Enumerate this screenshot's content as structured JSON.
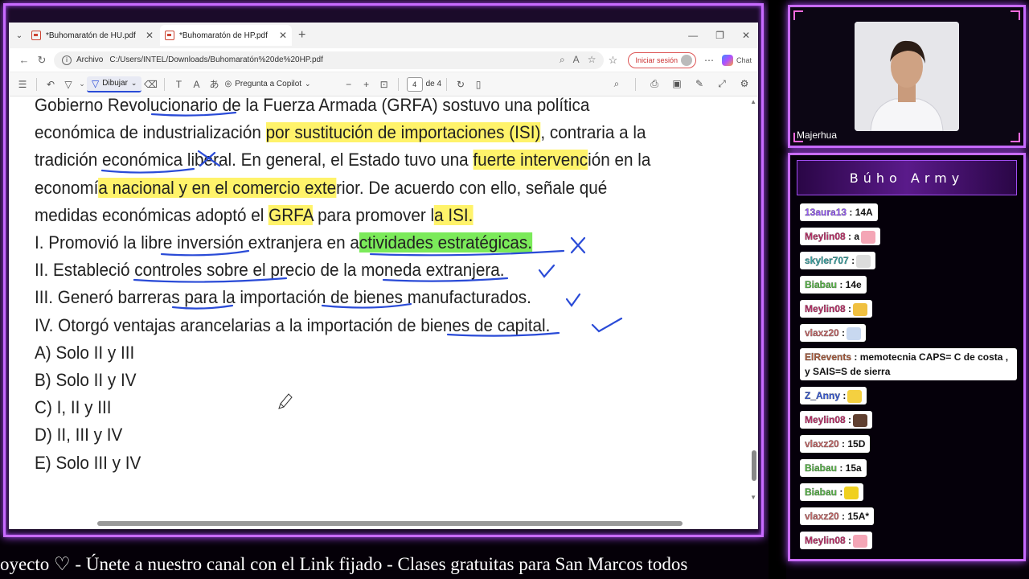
{
  "browser": {
    "tabs": [
      {
        "label": "*Buhomaratón de HU.pdf"
      },
      {
        "label": "*Buhomaratón de HP.pdf"
      }
    ],
    "address": {
      "label": "Archivo",
      "url": "C:/Users/INTEL/Downloads/Buhomaratón%20de%20HP.pdf"
    },
    "signin_label": "Iniciar sesión",
    "chat_label": "Chat"
  },
  "pdf_toolbar": {
    "draw_label": "Dibujar",
    "ask_label": "Pregunta a Copilot",
    "page_current": "4",
    "page_total": "de 4"
  },
  "document": {
    "para_lines": [
      [
        "Gobierno Revolucionario de la Fuerza Armada (GRFA) sostuvo una política"
      ],
      [
        "económica de industrialización ",
        {
          "hl": "por sustitución de importaciones (ISI)"
        },
        ", contraria a la"
      ],
      [
        "tradición económica liberal. En general, el Estado tuvo una ",
        {
          "hl": "fuerte intervenc"
        },
        "ión en la"
      ],
      [
        "economí",
        {
          "hl": "a nacional y en el comercio exte"
        },
        "rior. De acuerdo con ello, señale qué"
      ],
      [
        "medidas económicas adoptó el ",
        {
          "hl": "GRFA"
        },
        " para promover l",
        {
          "hl": "a ISI."
        }
      ]
    ],
    "statements": [
      [
        "I. Promovió la libre inversión extranjera en a",
        {
          "hlg": "ctividades estratégicas."
        }
      ],
      [
        "II. Estableció controles sobre el precio de la moneda extranjera."
      ],
      [
        "III. Generó barreras para la importación de bienes manufacturados."
      ],
      [
        "IV. Otorgó ventajas arancelarias a la importación de bienes de capital."
      ]
    ],
    "options": [
      "A) Solo II y III",
      "B) Solo II y IV",
      "C) I, II y III",
      "D) II, III y IV",
      "E) Solo III y IV"
    ]
  },
  "webcam": {
    "name": "Majerhua"
  },
  "chat": {
    "title": "Búho Army",
    "messages": [
      {
        "user": "13aura13",
        "text": ": 14A",
        "color": "#9a5cff"
      },
      {
        "user": "Meylin08",
        "text": ": a",
        "color": "#c0306a",
        "emote": "#f4a6b6"
      },
      {
        "user": "skyler707",
        "text": ":",
        "color": "#3aa6a6",
        "emote": "#dcdcdc"
      },
      {
        "user": "Biabau",
        "text": ": 14e",
        "color": "#58b848"
      },
      {
        "user": "Meylin08",
        "text": ":",
        "color": "#c0306a",
        "emote": "#f0c040"
      },
      {
        "user": "vlaxz20",
        "text": ":",
        "color": "#c86a6a",
        "emote": "#c8d8f0"
      },
      {
        "user": "ElRevents",
        "text": ": memotecnia CAPS= C de costa , y SAIS=S de sierra",
        "color": "#b06040"
      },
      {
        "user": "Z_Anny",
        "text": ":",
        "color": "#3a5cd8",
        "emote": "#f4d040"
      },
      {
        "user": "Meylin08",
        "text": ":",
        "color": "#c0306a",
        "emote": "#604030"
      },
      {
        "user": "vlaxz20",
        "text": ": 15D",
        "color": "#c86a6a"
      },
      {
        "user": "Biabau",
        "text": ": 15a",
        "color": "#58b848"
      },
      {
        "user": "Biabau",
        "text": ":",
        "color": "#58b848",
        "emote": "#f0d020"
      },
      {
        "user": "vlaxz20",
        "text": ": 15A*",
        "color": "#c86a6a"
      },
      {
        "user": "Meylin08",
        "text": ":",
        "color": "#c0306a",
        "emote": "#f4a6b6"
      }
    ]
  },
  "ticker": "oyecto  ♡   -   Únete a nuestro canal con el Link fijado  -  Clases gratuitas para San Marcos todos"
}
